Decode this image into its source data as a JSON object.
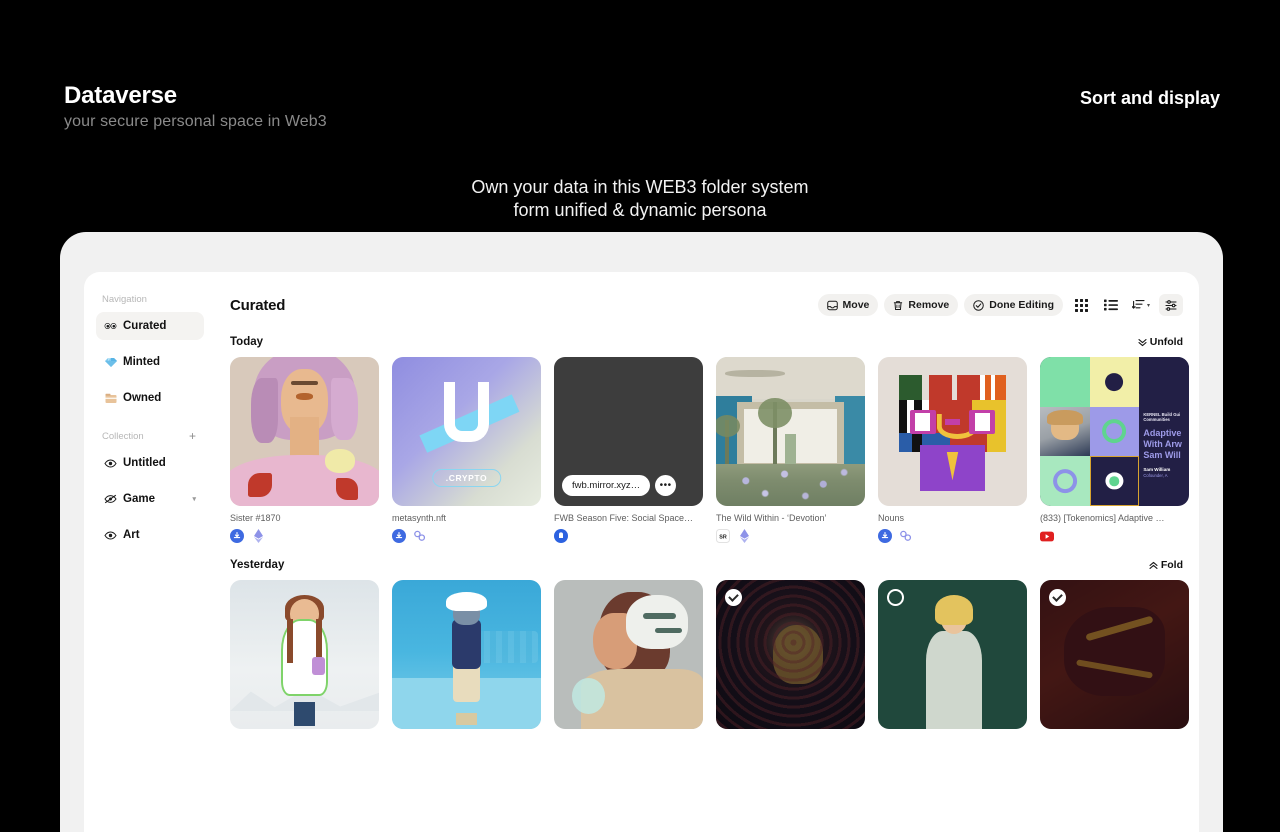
{
  "promo": {
    "title": "Dataverse",
    "subtitle": "your secure personal space in Web3",
    "sort_label": "Sort and display",
    "caption_line1": "Own your data in this WEB3 folder system",
    "caption_line2": "form unified & dynamic persona"
  },
  "sidebar": {
    "navigation_label": "Navigation",
    "collection_label": "Collection",
    "add_symbol": "+",
    "nav_items": [
      {
        "label": "Curated",
        "icon": "eyes-icon",
        "glyph": "👀",
        "active": true
      },
      {
        "label": "Minted",
        "icon": "diamond-icon",
        "glyph": "💎",
        "active": false
      },
      {
        "label": "Owned",
        "icon": "folder-icon",
        "glyph": "🗂",
        "active": false
      }
    ],
    "collection_items": [
      {
        "label": "Untitled",
        "icon": "eye-icon",
        "caret": ""
      },
      {
        "label": "Game",
        "icon": "eye-off-icon",
        "caret": "▾"
      },
      {
        "label": "Art",
        "icon": "eye-icon",
        "caret": ""
      }
    ]
  },
  "main": {
    "page_title": "Curated",
    "toolbar": {
      "move_label": "Move",
      "remove_label": "Remove",
      "done_label": "Done Editing",
      "grid_view_icon": "grid-view-icon",
      "list_view_icon": "list-view-icon",
      "sort_icon": "sort-icon",
      "settings_icon": "settings-sliders-icon",
      "caret": "▾"
    },
    "sections": [
      {
        "title": "Today",
        "fold_label": "Unfold",
        "fold_chevron": "»",
        "items": [
          {
            "title": "Sister #1870",
            "badges": [
              "arweave-badge",
              "ethereum-badge"
            ],
            "selected": false
          },
          {
            "title": "metasynth.nft",
            "badges": [
              "arweave-badge",
              "link-badge"
            ],
            "selected": false
          },
          {
            "title": "FWB Season Five: Social Space…",
            "badges": [
              "mirror-badge"
            ],
            "selected": false,
            "url_pill": "fwb.mirror.xyz…",
            "more_label": "•••"
          },
          {
            "title": "The Wild Within - ‘Devotion’",
            "badges": [
              "sr-badge",
              "ethereum-badge"
            ],
            "selected": false
          },
          {
            "title": "Nouns",
            "badges": [
              "arweave-badge",
              "link-badge"
            ],
            "selected": false
          },
          {
            "title": "(833) [Tokenomics] Adaptive …",
            "badges": [
              "youtube-badge"
            ],
            "selected": false
          }
        ]
      },
      {
        "title": "Yesterday",
        "fold_label": "Fold",
        "fold_chevron": "«",
        "items": [
          {
            "title": "",
            "badges": [],
            "selected": false
          },
          {
            "title": "",
            "badges": [],
            "selected": false
          },
          {
            "title": "",
            "badges": [],
            "selected": false
          },
          {
            "title": "",
            "badges": [],
            "selected": true,
            "mark": "checked"
          },
          {
            "title": "",
            "badges": [],
            "selected": false,
            "mark": "empty"
          },
          {
            "title": "",
            "badges": [],
            "selected": true,
            "mark": "checked"
          }
        ]
      }
    ]
  },
  "artwork": {
    "crypto_label": ".CRYPTO",
    "kernel_line1": "KERNEL Build Gui",
    "kernel_line2": "Communities",
    "kernel_title1": "Adaptive",
    "kernel_title2": "With Arw",
    "kernel_title3": "Sam Will",
    "kernel_name": "Sam William",
    "kernel_role": "Cofounder, A"
  },
  "colors": {
    "background": "#000000",
    "device_bezel": "#f1f1f1",
    "screen": "#ffffff",
    "accent_active": "#f4f3f1",
    "text_primary": "#111111",
    "text_muted": "#5e5e5e",
    "youtube_red": "#e02020",
    "arweave_blue": "#3e6ae1"
  }
}
